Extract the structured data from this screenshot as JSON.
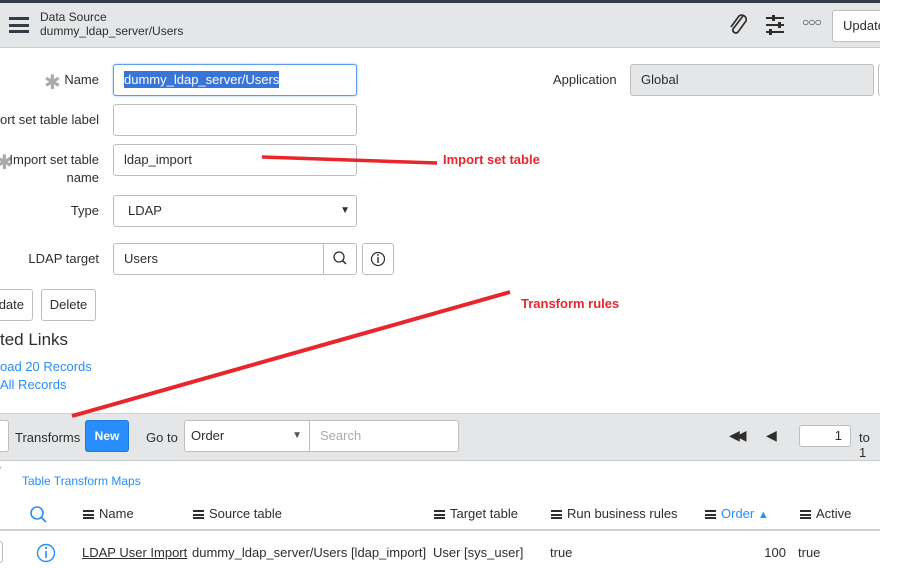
{
  "header": {
    "title": "Data Source",
    "subtitle": "dummy_ldap_server/Users",
    "update_label": "Update"
  },
  "form": {
    "name_label": "Name",
    "name_value": "dummy_ldap_server/Users",
    "import_label_label": "ort set table label",
    "import_label_value": "",
    "import_name_label_1": "Import set table",
    "import_name_label_2": "name",
    "import_name_value": "ldap_import",
    "type_label": "Type",
    "type_value": "LDAP",
    "ldap_target_label": "LDAP target",
    "ldap_target_value": "Users",
    "application_label": "Application",
    "application_value": "Global",
    "update_button": "date",
    "delete_button": "Delete"
  },
  "related_links": {
    "title": "ted Links",
    "links": [
      "oad 20 Records",
      "All Records"
    ]
  },
  "list": {
    "title": "Transforms",
    "new_label": "New",
    "goto_label": "Go to",
    "goto_value": "Order",
    "search_placeholder": "Search",
    "page_value": "1",
    "page_to": "to 1",
    "breadcrumb": "Table Transform Maps",
    "columns": [
      "Name",
      "Source table",
      "Target table",
      "Run business rules",
      "Order",
      "Active"
    ],
    "rows": [
      {
        "name": "LDAP User Import",
        "source": "dummy_ldap_server/Users [ldap_import]",
        "target": "User [sys_user]",
        "run_rules": "true",
        "order": "100",
        "active": "true"
      }
    ]
  },
  "annotations": {
    "import_set": "Import set table",
    "transform": "Transform rules"
  },
  "colors": {
    "accent": "#278efc",
    "annotation": "#e8262c",
    "header_bg": "#e4e6e7"
  }
}
